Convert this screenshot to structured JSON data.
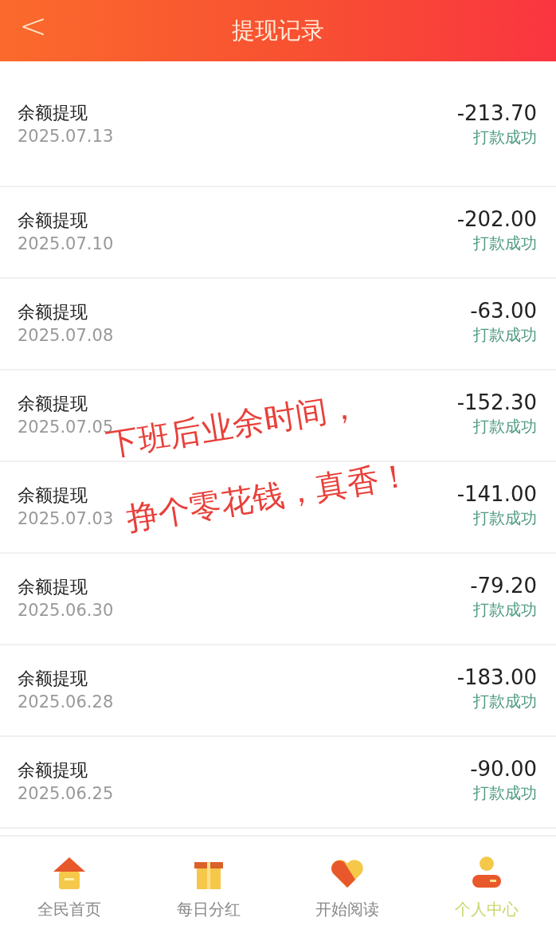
{
  "header": {
    "back": "<",
    "title": "提现记录"
  },
  "records": [
    {
      "title": "余额提现",
      "date": "2025.07.13",
      "amount": "-213.70",
      "status": "打款成功"
    },
    {
      "title": "余额提现",
      "date": "2025.07.10",
      "amount": "-202.00",
      "status": "打款成功"
    },
    {
      "title": "余额提现",
      "date": "2025.07.08",
      "amount": "-63.00",
      "status": "打款成功"
    },
    {
      "title": "余额提现",
      "date": "2025.07.05",
      "amount": "-152.30",
      "status": "打款成功"
    },
    {
      "title": "余额提现",
      "date": "2025.07.03",
      "amount": "-141.00",
      "status": "打款成功"
    },
    {
      "title": "余额提现",
      "date": "2025.06.30",
      "amount": "-79.20",
      "status": "打款成功"
    },
    {
      "title": "余额提现",
      "date": "2025.06.28",
      "amount": "-183.00",
      "status": "打款成功"
    },
    {
      "title": "余额提现",
      "date": "2025.06.25",
      "amount": "-90.00",
      "status": "打款成功"
    }
  ],
  "overlay_caption": [
    "下班后业余时间，",
    "挣个零花钱，真香！"
  ],
  "tabs": [
    {
      "kind": "home",
      "label": "全民首页",
      "selected": false
    },
    {
      "kind": "gift",
      "label": "每日分红",
      "selected": false
    },
    {
      "kind": "heart",
      "label": "开始阅读",
      "selected": false
    },
    {
      "kind": "user",
      "label": "个人中心",
      "selected": true
    }
  ]
}
